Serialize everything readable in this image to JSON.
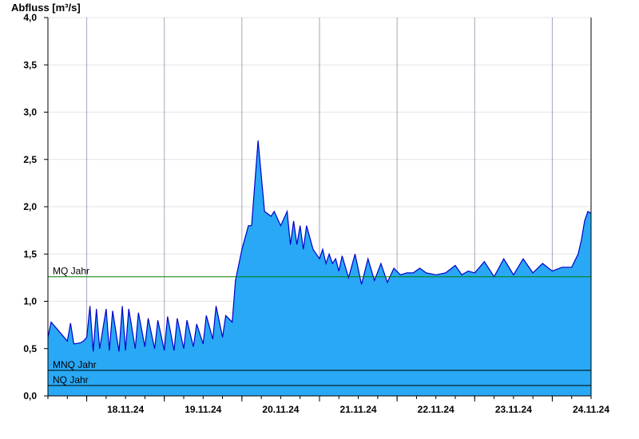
{
  "chart_data": {
    "type": "area",
    "ylabel": "Abfluss [m³/s]",
    "ylim": [
      0,
      4.0
    ],
    "xlim": [
      "2024-11-17T12:00",
      "2024-11-24T12:00"
    ],
    "yticks": [
      {
        "value": 0.0,
        "label": "0,0"
      },
      {
        "value": 0.5,
        "label": "0,5"
      },
      {
        "value": 1.0,
        "label": "1,0"
      },
      {
        "value": 1.5,
        "label": "1,5"
      },
      {
        "value": 2.0,
        "label": "2,0"
      },
      {
        "value": 2.5,
        "label": "2,5"
      },
      {
        "value": 3.0,
        "label": "3,0"
      },
      {
        "value": 3.5,
        "label": "3,5"
      },
      {
        "value": 4.0,
        "label": "4,0"
      }
    ],
    "xticks": [
      {
        "value": "2024-11-18T00:00",
        "label": "18.11.24"
      },
      {
        "value": "2024-11-19T00:00",
        "label": "19.11.24"
      },
      {
        "value": "2024-11-20T00:00",
        "label": "20.11.24"
      },
      {
        "value": "2024-11-21T00:00",
        "label": "21.11.24"
      },
      {
        "value": "2024-11-22T00:00",
        "label": "22.11.24"
      },
      {
        "value": "2024-11-23T00:00",
        "label": "23.11.24"
      },
      {
        "value": "2024-11-24T00:00",
        "label": "24.11.24"
      }
    ],
    "grid": true,
    "reference_lines": [
      {
        "name": "MQ Jahr",
        "value": 1.26,
        "color": "#008000"
      },
      {
        "name": "MNQ Jahr",
        "value": 0.27,
        "color": "#000000"
      },
      {
        "name": "NQ Jahr",
        "value": 0.11,
        "color": "#000000"
      }
    ],
    "series": [
      {
        "fill_color": "#29a8f5",
        "line_color": "#0000cc",
        "x": [
          "2024-11-17T12:00",
          "2024-11-17T13:00",
          "2024-11-17T14:00",
          "2024-11-17T16:00",
          "2024-11-17T18:00",
          "2024-11-17T19:00",
          "2024-11-17T20:00",
          "2024-11-17T22:00",
          "2024-11-17T23:00",
          "2024-11-18T00:00",
          "2024-11-18T01:00",
          "2024-11-18T02:00",
          "2024-11-18T03:00",
          "2024-11-18T04:00",
          "2024-11-18T06:00",
          "2024-11-18T07:00",
          "2024-11-18T08:00",
          "2024-11-18T10:00",
          "2024-11-18T11:00",
          "2024-11-18T12:00",
          "2024-11-18T13:00",
          "2024-11-18T15:00",
          "2024-11-18T16:00",
          "2024-11-18T18:00",
          "2024-11-18T19:00",
          "2024-11-18T21:00",
          "2024-11-18T22:00",
          "2024-11-19T00:00",
          "2024-11-19T01:00",
          "2024-11-19T03:00",
          "2024-11-19T04:00",
          "2024-11-19T06:00",
          "2024-11-19T07:00",
          "2024-11-19T09:00",
          "2024-11-19T10:00",
          "2024-11-19T12:00",
          "2024-11-19T13:00",
          "2024-11-19T15:00",
          "2024-11-19T16:00",
          "2024-11-19T18:00",
          "2024-11-19T19:00",
          "2024-11-19T21:00",
          "2024-11-19T22:00",
          "2024-11-20T00:00",
          "2024-11-20T02:00",
          "2024-11-20T03:00",
          "2024-11-20T05:00",
          "2024-11-20T07:00",
          "2024-11-20T09:00",
          "2024-11-20T10:00",
          "2024-11-20T12:00",
          "2024-11-20T14:00",
          "2024-11-20T15:00",
          "2024-11-20T16:00",
          "2024-11-20T17:00",
          "2024-11-20T18:00",
          "2024-11-20T19:00",
          "2024-11-20T20:00",
          "2024-11-20T22:00",
          "2024-11-21T00:00",
          "2024-11-21T01:00",
          "2024-11-21T02:00",
          "2024-11-21T03:00",
          "2024-11-21T04:00",
          "2024-11-21T05:00",
          "2024-11-21T06:00",
          "2024-11-21T07:00",
          "2024-11-21T09:00",
          "2024-11-21T11:00",
          "2024-11-21T13:00",
          "2024-11-21T15:00",
          "2024-11-21T17:00",
          "2024-11-21T19:00",
          "2024-11-21T21:00",
          "2024-11-21T23:00",
          "2024-11-22T01:00",
          "2024-11-22T03:00",
          "2024-11-22T05:00",
          "2024-11-22T07:00",
          "2024-11-22T09:00",
          "2024-11-22T12:00",
          "2024-11-22T15:00",
          "2024-11-22T18:00",
          "2024-11-22T20:00",
          "2024-11-22T22:00",
          "2024-11-23T00:00",
          "2024-11-23T03:00",
          "2024-11-23T06:00",
          "2024-11-23T09:00",
          "2024-11-23T12:00",
          "2024-11-23T15:00",
          "2024-11-23T18:00",
          "2024-11-23T21:00",
          "2024-11-24T00:00",
          "2024-11-24T03:00",
          "2024-11-24T06:00",
          "2024-11-24T08:00",
          "2024-11-24T09:00",
          "2024-11-24T10:00",
          "2024-11-24T11:00",
          "2024-11-24T12:00"
        ],
        "values": [
          0.62,
          0.78,
          0.74,
          0.66,
          0.58,
          0.77,
          0.55,
          0.56,
          0.58,
          0.62,
          0.95,
          0.47,
          0.92,
          0.5,
          0.92,
          0.48,
          0.9,
          0.47,
          0.95,
          0.48,
          0.92,
          0.5,
          0.88,
          0.52,
          0.82,
          0.5,
          0.8,
          0.48,
          0.84,
          0.48,
          0.82,
          0.5,
          0.8,
          0.52,
          0.76,
          0.55,
          0.85,
          0.6,
          0.95,
          0.62,
          0.85,
          0.78,
          1.22,
          1.55,
          1.8,
          1.8,
          2.7,
          1.95,
          1.9,
          1.95,
          1.8,
          1.95,
          1.6,
          1.85,
          1.6,
          1.8,
          1.55,
          1.8,
          1.55,
          1.45,
          1.55,
          1.4,
          1.5,
          1.4,
          1.45,
          1.32,
          1.48,
          1.25,
          1.5,
          1.18,
          1.45,
          1.22,
          1.4,
          1.2,
          1.35,
          1.28,
          1.3,
          1.3,
          1.35,
          1.3,
          1.28,
          1.3,
          1.38,
          1.28,
          1.32,
          1.3,
          1.42,
          1.26,
          1.45,
          1.28,
          1.45,
          1.3,
          1.4,
          1.32,
          1.36,
          1.36,
          1.5,
          1.65,
          1.85,
          1.95,
          1.93
        ]
      }
    ]
  }
}
